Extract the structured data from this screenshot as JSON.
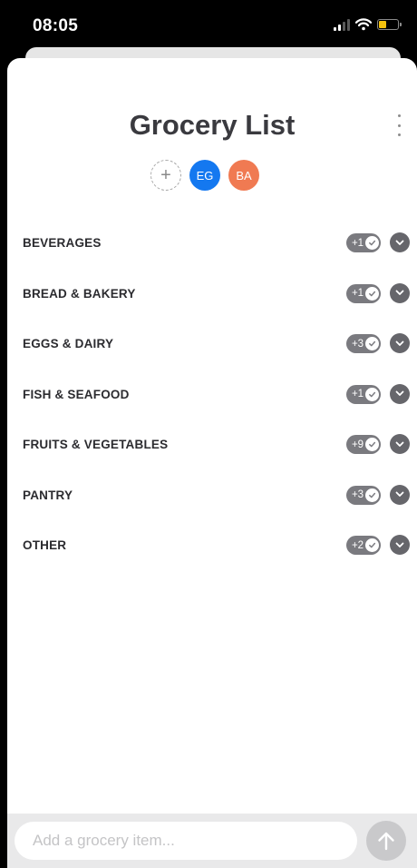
{
  "status_bar": {
    "time": "08:05"
  },
  "header": {
    "title": "Grocery List"
  },
  "collaborators": {
    "add_symbol": "+",
    "members": [
      {
        "initials": "EG",
        "color": "#1478f0"
      },
      {
        "initials": "BA",
        "color": "#f07a52"
      }
    ]
  },
  "categories": [
    {
      "label": "BEVERAGES",
      "count": "+1"
    },
    {
      "label": "BREAD & BAKERY",
      "count": "+1"
    },
    {
      "label": "EGGS & DAIRY",
      "count": "+3"
    },
    {
      "label": "FISH & SEAFOOD",
      "count": "+1"
    },
    {
      "label": "FRUITS & VEGETABLES",
      "count": "+9"
    },
    {
      "label": "PANTRY",
      "count": "+3"
    },
    {
      "label": "OTHER",
      "count": "+2"
    }
  ],
  "input_bar": {
    "placeholder": "Add a grocery item..."
  },
  "icons": {
    "check": "check-icon",
    "chevron": "chevron-down-icon",
    "more": "more-vertical-icon",
    "send": "arrow-up-icon"
  },
  "colors": {
    "pill": "#7a7a7f",
    "chevron_bg": "#66666b",
    "send_button": "#c9c9cb"
  }
}
